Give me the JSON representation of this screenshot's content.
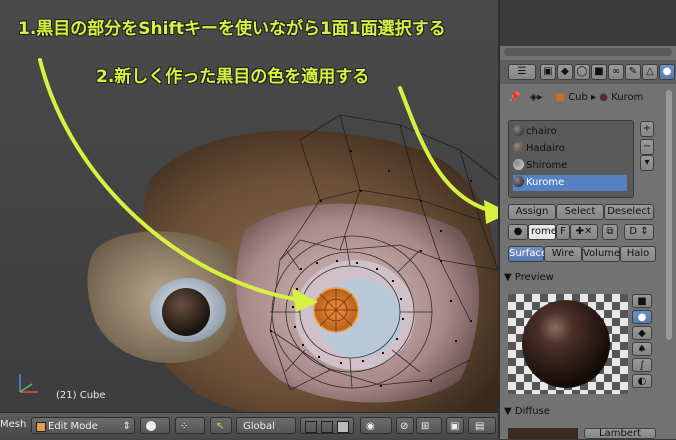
{
  "annotations": {
    "line1": "1.黒目の部分をShiftキーを使いながら1面1面選択する",
    "line2": "2.新しく作った黒目の色を適用する"
  },
  "viewport": {
    "object_info": "(21) Cube"
  },
  "bottom_bar": {
    "editor_label": "Mesh",
    "mode": "Edit Mode",
    "orientation": "Global"
  },
  "panel": {
    "breadcrumb": {
      "object": "Cub",
      "material": "Kurom"
    },
    "material_slots": [
      {
        "name": "chairo",
        "color": "#2a1a10"
      },
      {
        "name": "Hadairo",
        "color": "#5a3a2a"
      },
      {
        "name": "Shirome",
        "color": "#d8d8d8"
      },
      {
        "name": "Kurome",
        "color": "#1a1a1a"
      }
    ],
    "selected_slot": 3,
    "buttons": {
      "assign": "Assign",
      "select": "Select",
      "deselect": "Deselect"
    },
    "material_field": "rome",
    "material_f": "F",
    "data_label": "D",
    "tabs": [
      "Surface",
      "Wire",
      "Volume",
      "Halo"
    ],
    "active_tab": 0,
    "preview_header": "Preview",
    "diffuse_header": "Diffuse",
    "diffuse_shader": "Lambert"
  }
}
